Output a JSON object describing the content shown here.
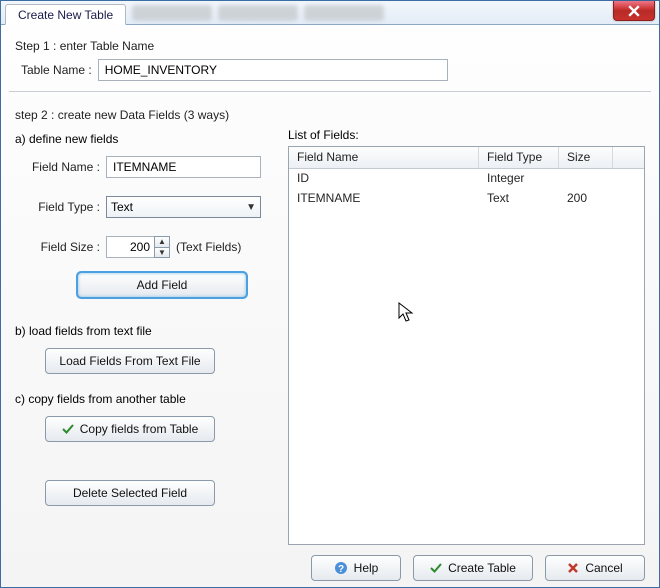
{
  "window": {
    "title": "Create New Table"
  },
  "step1_label": "Step 1 : enter Table Name",
  "table_name_label": "Table Name :",
  "table_name_value": "HOME_INVENTORY",
  "step2_label": "step 2 : create new Data Fields (3 ways)",
  "sectionA_label": "a) define new fields",
  "field_name_label": "Field Name :",
  "field_name_value": "ITEMNAME",
  "field_type_label": "Field Type :",
  "field_type_value": "Text",
  "field_size_label": "Field Size :",
  "field_size_value": "200",
  "field_size_suffix": "(Text Fields)",
  "add_field_label": "Add Field",
  "sectionB_label": "b) load fields from text file",
  "load_file_label": "Load Fields From Text File",
  "sectionC_label": "c) copy fields from another table",
  "copy_fields_label": "Copy fields from Table",
  "delete_selected_label": "Delete Selected Field",
  "list_of_fields_label": "List of Fields:",
  "columns": {
    "name": "Field Name",
    "type": "Field Type",
    "size": "Size"
  },
  "fields": [
    {
      "name": "ID",
      "type": "Integer",
      "size": ""
    },
    {
      "name": "ITEMNAME",
      "type": "Text",
      "size": "200"
    }
  ],
  "footer": {
    "help": "Help",
    "create": "Create Table",
    "cancel": "Cancel"
  }
}
